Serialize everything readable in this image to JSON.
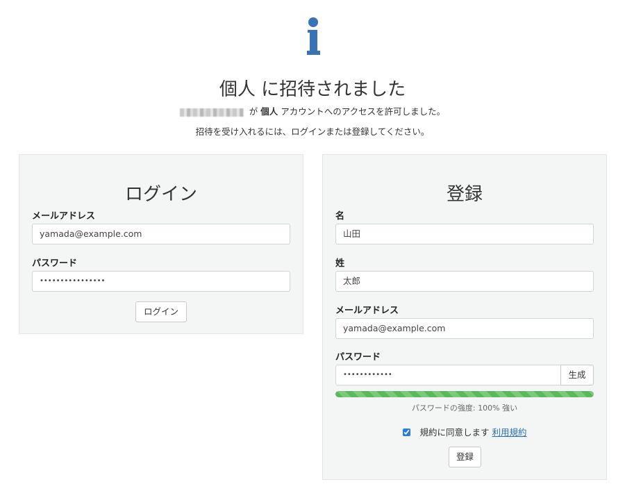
{
  "header": {
    "title": "個人 に招待されました",
    "invite_inviter_suffix": "が",
    "invite_account_name": "個人",
    "invite_message": "アカウントへのアクセスを許可しました。",
    "instruction": "招待を受け入れるには、ログインまたは登録してください。"
  },
  "login": {
    "heading": "ログイン",
    "email_label": "メールアドレス",
    "email_value": "yamada@example.com",
    "password_label": "パスワード",
    "password_value": "••••••••••••••••",
    "submit_label": "ログイン"
  },
  "register": {
    "heading": "登録",
    "first_name_label": "名",
    "first_name_value": "山田",
    "last_name_label": "姓",
    "last_name_value": "太郎",
    "email_label": "メールアドレス",
    "email_value": "yamada@example.com",
    "password_label": "パスワード",
    "password_value": "••••••••••••",
    "generate_label": "生成",
    "strength_percent": 100,
    "strength_text": "パスワードの強度: 100% 強い",
    "terms_text": "規約に同意します",
    "terms_link": "利用規約",
    "terms_checked": true,
    "submit_label": "登録"
  },
  "colors": {
    "icon": "#3a73b5",
    "panel_bg": "#f4f5f5",
    "strength_bar": "#5cb85c",
    "link": "#2a6fb8"
  },
  "icons": {
    "header": "info-icon"
  }
}
